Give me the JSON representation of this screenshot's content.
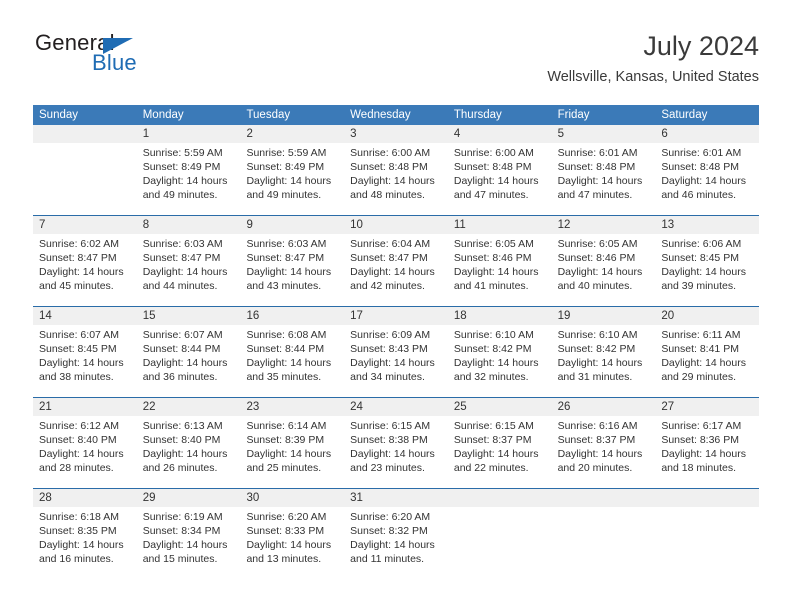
{
  "brand": {
    "name_top": "General",
    "name_bottom": "Blue",
    "accent_color": "#1f6cb4",
    "triangle_icon": "triangle-icon"
  },
  "header": {
    "month_title": "July 2024",
    "location": "Wellsville, Kansas, United States"
  },
  "theme": {
    "header_bar_color": "#3b7ab8",
    "row_divider_color": "#2a6ca8",
    "daynum_band_color": "#f0f0f0",
    "text_color": "#333333"
  },
  "calendar": {
    "weekdays": [
      "Sunday",
      "Monday",
      "Tuesday",
      "Wednesday",
      "Thursday",
      "Friday",
      "Saturday"
    ],
    "weeks": [
      [
        {
          "day": "",
          "sunrise": "",
          "sunset": "",
          "daylight": ""
        },
        {
          "day": "1",
          "sunrise": "Sunrise: 5:59 AM",
          "sunset": "Sunset: 8:49 PM",
          "daylight": "Daylight: 14 hours and 49 minutes."
        },
        {
          "day": "2",
          "sunrise": "Sunrise: 5:59 AM",
          "sunset": "Sunset: 8:49 PM",
          "daylight": "Daylight: 14 hours and 49 minutes."
        },
        {
          "day": "3",
          "sunrise": "Sunrise: 6:00 AM",
          "sunset": "Sunset: 8:48 PM",
          "daylight": "Daylight: 14 hours and 48 minutes."
        },
        {
          "day": "4",
          "sunrise": "Sunrise: 6:00 AM",
          "sunset": "Sunset: 8:48 PM",
          "daylight": "Daylight: 14 hours and 47 minutes."
        },
        {
          "day": "5",
          "sunrise": "Sunrise: 6:01 AM",
          "sunset": "Sunset: 8:48 PM",
          "daylight": "Daylight: 14 hours and 47 minutes."
        },
        {
          "day": "6",
          "sunrise": "Sunrise: 6:01 AM",
          "sunset": "Sunset: 8:48 PM",
          "daylight": "Daylight: 14 hours and 46 minutes."
        }
      ],
      [
        {
          "day": "7",
          "sunrise": "Sunrise: 6:02 AM",
          "sunset": "Sunset: 8:47 PM",
          "daylight": "Daylight: 14 hours and 45 minutes."
        },
        {
          "day": "8",
          "sunrise": "Sunrise: 6:03 AM",
          "sunset": "Sunset: 8:47 PM",
          "daylight": "Daylight: 14 hours and 44 minutes."
        },
        {
          "day": "9",
          "sunrise": "Sunrise: 6:03 AM",
          "sunset": "Sunset: 8:47 PM",
          "daylight": "Daylight: 14 hours and 43 minutes."
        },
        {
          "day": "10",
          "sunrise": "Sunrise: 6:04 AM",
          "sunset": "Sunset: 8:47 PM",
          "daylight": "Daylight: 14 hours and 42 minutes."
        },
        {
          "day": "11",
          "sunrise": "Sunrise: 6:05 AM",
          "sunset": "Sunset: 8:46 PM",
          "daylight": "Daylight: 14 hours and 41 minutes."
        },
        {
          "day": "12",
          "sunrise": "Sunrise: 6:05 AM",
          "sunset": "Sunset: 8:46 PM",
          "daylight": "Daylight: 14 hours and 40 minutes."
        },
        {
          "day": "13",
          "sunrise": "Sunrise: 6:06 AM",
          "sunset": "Sunset: 8:45 PM",
          "daylight": "Daylight: 14 hours and 39 minutes."
        }
      ],
      [
        {
          "day": "14",
          "sunrise": "Sunrise: 6:07 AM",
          "sunset": "Sunset: 8:45 PM",
          "daylight": "Daylight: 14 hours and 38 minutes."
        },
        {
          "day": "15",
          "sunrise": "Sunrise: 6:07 AM",
          "sunset": "Sunset: 8:44 PM",
          "daylight": "Daylight: 14 hours and 36 minutes."
        },
        {
          "day": "16",
          "sunrise": "Sunrise: 6:08 AM",
          "sunset": "Sunset: 8:44 PM",
          "daylight": "Daylight: 14 hours and 35 minutes."
        },
        {
          "day": "17",
          "sunrise": "Sunrise: 6:09 AM",
          "sunset": "Sunset: 8:43 PM",
          "daylight": "Daylight: 14 hours and 34 minutes."
        },
        {
          "day": "18",
          "sunrise": "Sunrise: 6:10 AM",
          "sunset": "Sunset: 8:42 PM",
          "daylight": "Daylight: 14 hours and 32 minutes."
        },
        {
          "day": "19",
          "sunrise": "Sunrise: 6:10 AM",
          "sunset": "Sunset: 8:42 PM",
          "daylight": "Daylight: 14 hours and 31 minutes."
        },
        {
          "day": "20",
          "sunrise": "Sunrise: 6:11 AM",
          "sunset": "Sunset: 8:41 PM",
          "daylight": "Daylight: 14 hours and 29 minutes."
        }
      ],
      [
        {
          "day": "21",
          "sunrise": "Sunrise: 6:12 AM",
          "sunset": "Sunset: 8:40 PM",
          "daylight": "Daylight: 14 hours and 28 minutes."
        },
        {
          "day": "22",
          "sunrise": "Sunrise: 6:13 AM",
          "sunset": "Sunset: 8:40 PM",
          "daylight": "Daylight: 14 hours and 26 minutes."
        },
        {
          "day": "23",
          "sunrise": "Sunrise: 6:14 AM",
          "sunset": "Sunset: 8:39 PM",
          "daylight": "Daylight: 14 hours and 25 minutes."
        },
        {
          "day": "24",
          "sunrise": "Sunrise: 6:15 AM",
          "sunset": "Sunset: 8:38 PM",
          "daylight": "Daylight: 14 hours and 23 minutes."
        },
        {
          "day": "25",
          "sunrise": "Sunrise: 6:15 AM",
          "sunset": "Sunset: 8:37 PM",
          "daylight": "Daylight: 14 hours and 22 minutes."
        },
        {
          "day": "26",
          "sunrise": "Sunrise: 6:16 AM",
          "sunset": "Sunset: 8:37 PM",
          "daylight": "Daylight: 14 hours and 20 minutes."
        },
        {
          "day": "27",
          "sunrise": "Sunrise: 6:17 AM",
          "sunset": "Sunset: 8:36 PM",
          "daylight": "Daylight: 14 hours and 18 minutes."
        }
      ],
      [
        {
          "day": "28",
          "sunrise": "Sunrise: 6:18 AM",
          "sunset": "Sunset: 8:35 PM",
          "daylight": "Daylight: 14 hours and 16 minutes."
        },
        {
          "day": "29",
          "sunrise": "Sunrise: 6:19 AM",
          "sunset": "Sunset: 8:34 PM",
          "daylight": "Daylight: 14 hours and 15 minutes."
        },
        {
          "day": "30",
          "sunrise": "Sunrise: 6:20 AM",
          "sunset": "Sunset: 8:33 PM",
          "daylight": "Daylight: 14 hours and 13 minutes."
        },
        {
          "day": "31",
          "sunrise": "Sunrise: 6:20 AM",
          "sunset": "Sunset: 8:32 PM",
          "daylight": "Daylight: 14 hours and 11 minutes."
        },
        {
          "day": "",
          "sunrise": "",
          "sunset": "",
          "daylight": ""
        },
        {
          "day": "",
          "sunrise": "",
          "sunset": "",
          "daylight": ""
        },
        {
          "day": "",
          "sunrise": "",
          "sunset": "",
          "daylight": ""
        }
      ]
    ]
  }
}
